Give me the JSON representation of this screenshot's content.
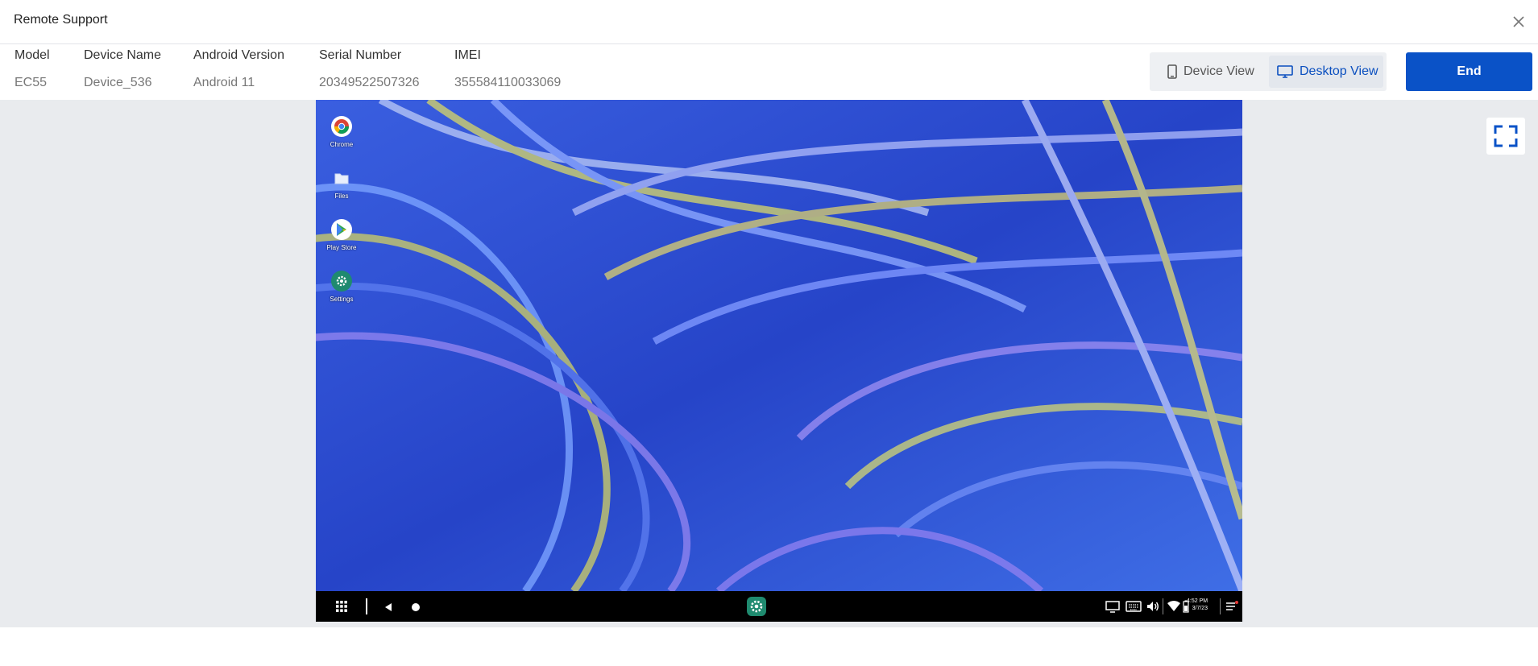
{
  "window": {
    "title": "Remote Support",
    "close_icon": "close-icon"
  },
  "device_info": [
    {
      "label": "Model",
      "value": "EC55"
    },
    {
      "label": "Device Name",
      "value": "Device_536"
    },
    {
      "label": "Android Version",
      "value": "Android 11"
    },
    {
      "label": "Serial Number",
      "value": "20349522507326"
    },
    {
      "label": "IMEI",
      "value": "355584110033069"
    }
  ],
  "view_toggle": {
    "device_view": {
      "label": "Device View",
      "icon": "phone-icon",
      "selected": false
    },
    "desktop_view": {
      "label": "Desktop View",
      "icon": "monitor-icon",
      "selected": true
    }
  },
  "end_button": {
    "label": "End"
  },
  "fullscreen": {
    "icon": "fullscreen-icon"
  },
  "desktop": {
    "apps": [
      {
        "label": "Chrome",
        "icon": "chrome-icon"
      },
      {
        "label": "Files",
        "icon": "folder-icon"
      },
      {
        "label": "Play Store",
        "icon": "play-store-icon"
      },
      {
        "label": "Settings",
        "icon": "settings-icon"
      }
    ],
    "taskbar": {
      "time": "4:52 PM",
      "date": "3/7/23",
      "icons": [
        "app-drawer-icon",
        "back-icon",
        "home-icon",
        "settings-icon",
        "screen-cast-icon",
        "keyboard-icon",
        "volume-icon",
        "wifi-icon",
        "battery-icon",
        "notifications-icon"
      ]
    }
  },
  "colors": {
    "accent": "#0a52c7",
    "stage_bg": "#e9ebee",
    "taskbar_bg": "#000000",
    "settings_green": "#1f8a6f"
  }
}
